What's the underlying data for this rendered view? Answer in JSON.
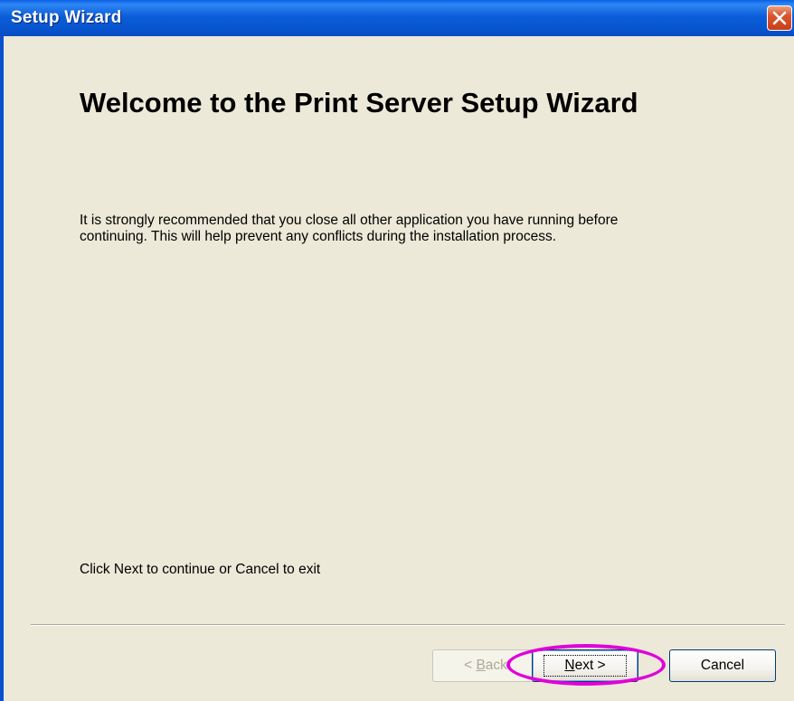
{
  "window": {
    "title": "Setup Wizard"
  },
  "content": {
    "heading": "Welcome to the Print Server Setup Wizard",
    "paragraph": "It is strongly recommended that you close all other application you have running before continuing. This will help prevent any conflicts during the installation process.",
    "footer_note": "Click Next to continue or Cancel to exit"
  },
  "buttons": {
    "back_label_prefix": "< ",
    "back_accel": "B",
    "back_label_rest": "ack",
    "next_accel": "N",
    "next_label_rest": "ext >",
    "cancel_label": "Cancel"
  },
  "colors": {
    "titlebar": "#0b5ed8",
    "dialog_bg": "#ece9d8",
    "highlight": "#e000d8",
    "close_button": "#d9542e"
  },
  "icons": {
    "close": "close-icon"
  }
}
